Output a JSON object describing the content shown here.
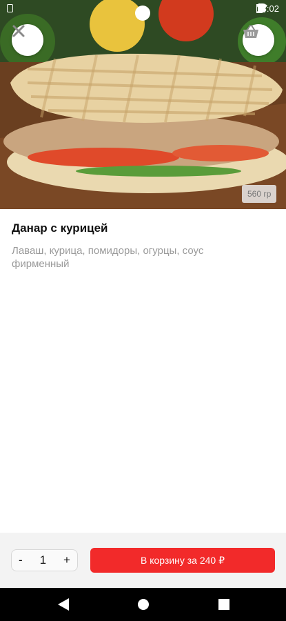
{
  "status_bar": {
    "time": "18:02"
  },
  "product": {
    "title": "Данар с курицей",
    "description": "Лаваш, курица, помидоры, огурцы, соус фирменный",
    "weight": "560 гр"
  },
  "cart": {
    "quantity": "1",
    "minus_label": "-",
    "plus_label": "+",
    "add_label": "В корзину за 240 ₽"
  },
  "icons": {
    "close": "close-icon",
    "basket": "basket-icon",
    "back": "nav-back-icon",
    "home": "nav-home-icon",
    "recents": "nav-recents-icon"
  },
  "colors": {
    "accent": "#f22a2a",
    "bottom_bar": "#f3f3f3"
  }
}
